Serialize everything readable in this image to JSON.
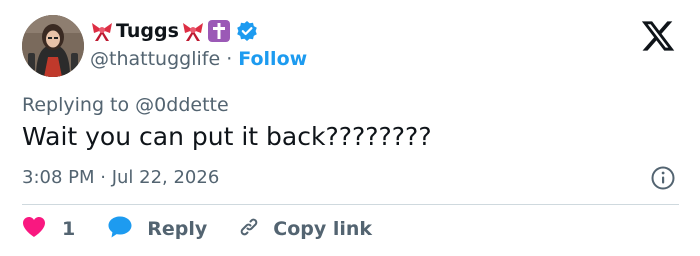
{
  "author": {
    "display_name": "Tuggs",
    "handle": "@thattugglife",
    "follow_label": "Follow",
    "separator": "·"
  },
  "reply_context": {
    "prefix": "Replying to",
    "mention": "@0ddette"
  },
  "tweet": {
    "text": "Wait you can put it back????????",
    "timestamp": "3:08 PM · Jul 22, 2026"
  },
  "actions": {
    "like_count": "1",
    "reply_label": "Reply",
    "copy_link_label": "Copy link"
  },
  "icons": {
    "brand": "x-logo-icon",
    "verified": "verified-badge-icon",
    "info": "info-icon",
    "like": "heart-icon",
    "reply": "speech-bubble-icon",
    "copy": "link-icon"
  },
  "colors": {
    "accent": "#1d9bf0",
    "like": "#f91880",
    "text": "#0f1419",
    "secondary": "#536471",
    "divider": "#cfd9de"
  }
}
